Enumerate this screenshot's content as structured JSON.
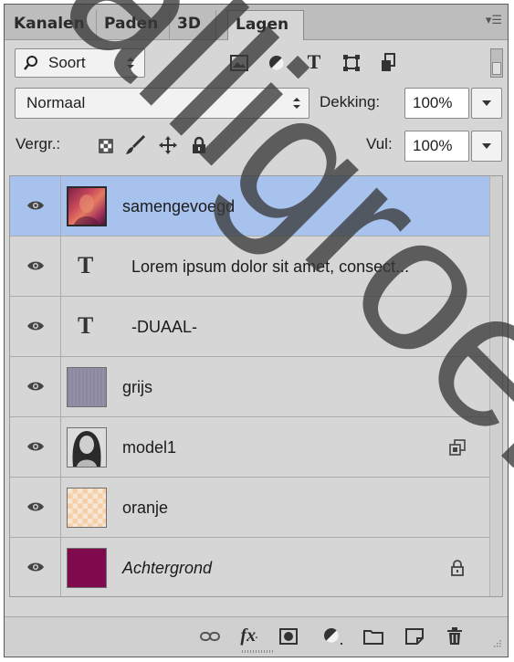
{
  "tabs": [
    {
      "label": "Kanalen"
    },
    {
      "label": "Paden"
    },
    {
      "label": "3D"
    },
    {
      "label": "Lagen"
    }
  ],
  "filter": {
    "label": "Soort"
  },
  "blend_mode": {
    "value": "Normaal"
  },
  "opacity": {
    "label": "Dekking:",
    "value": "100%"
  },
  "lock": {
    "label": "Vergr.:"
  },
  "fill": {
    "label": "Vul:",
    "value": "100%"
  },
  "layers": [
    {
      "name": "samengevoegd",
      "type": "image",
      "selected": true
    },
    {
      "name": "Lorem ipsum dolor sit amet, consect...",
      "type": "text",
      "icon": "T"
    },
    {
      "name": "-DUAAL-",
      "type": "text",
      "icon": "T"
    },
    {
      "name": "grijs",
      "type": "fill",
      "color": "#8e8aa2"
    },
    {
      "name": "model1",
      "type": "image",
      "badge": "smart-object-icon"
    },
    {
      "name": "oranje",
      "type": "pattern",
      "color": "#f5c79d"
    },
    {
      "name": "Achtergrond",
      "type": "fill",
      "color": "#7f0a4e",
      "badge": "lock-icon",
      "italic": true
    }
  ],
  "watermark": "alligroen",
  "colors": {
    "selected_row": "#a8c2ee",
    "panel_bg": "#d6d6d6"
  }
}
